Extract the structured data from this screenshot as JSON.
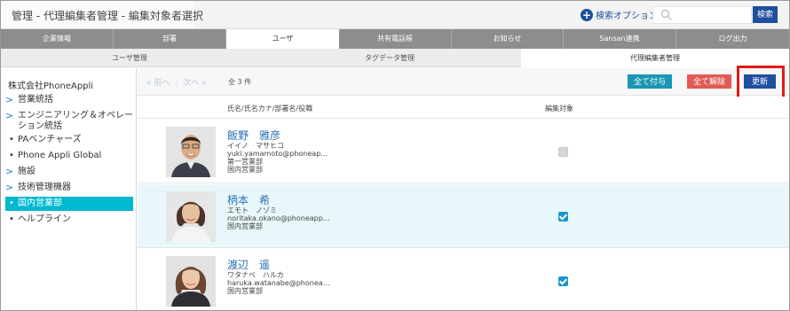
{
  "header": {
    "breadcrumb": "管理 - 代理編集者管理 - 編集対象者選択",
    "search_option_label": "検索オプション",
    "search_placeholder": "",
    "search_button": "検索"
  },
  "tabs": [
    "企業情報",
    "部署",
    "ユーザ",
    "共有電話帳",
    "お知らせ",
    "Sansan連携",
    "ログ出力"
  ],
  "subtabs": [
    "ユーザ管理",
    "タグデータ管理",
    "代理編集者管理"
  ],
  "sidebar": {
    "company": "株式会社PhoneAppli",
    "items": [
      {
        "label": "営業統括",
        "marker": ">"
      },
      {
        "label": "エンジニアリング＆オペレー",
        "label2": "ション統括",
        "marker": ">"
      },
      {
        "label": "PAベンチャーズ",
        "marker": "•"
      },
      {
        "label": "Phone Appli Global",
        "marker": "•"
      },
      {
        "label": "施設",
        "marker": ">"
      },
      {
        "label": "技術管理機器",
        "marker": ">"
      },
      {
        "label": "国内営業部",
        "marker": "•"
      },
      {
        "label": "ヘルプライン",
        "marker": "•"
      }
    ]
  },
  "toolbar": {
    "prev": "« 前へ",
    "next": "次へ »",
    "count": "全 3 件",
    "grant_all": "全て付与",
    "clear_all": "全て解除",
    "update": "更新"
  },
  "columns": {
    "name": "氏名/氏名カナ/部署名/役職",
    "target": "編集対象"
  },
  "people": [
    {
      "name": "飯野　雅彦",
      "kana": "イイノ　マサヒコ",
      "email": "yuki.yamamoto@phoneap…",
      "dept1": "第一営業部",
      "dept2": "国内営業部",
      "checked": false
    },
    {
      "name": "柄本　希",
      "kana": "エモト　ノゾミ",
      "email": "noritaka.okano@phoneapp…",
      "dept1": "国内営業部",
      "dept2": "",
      "checked": true
    },
    {
      "name": "渡辺　遥",
      "kana": "ワタナベ　ハルカ",
      "email": "haruka.watanabe@phonea…",
      "dept1": "国内営業部",
      "dept2": "",
      "checked": true
    }
  ],
  "colors": {
    "accent_blue": "#1f4fa0",
    "teal_button": "#1b96b3",
    "red_button": "#e15a54",
    "active_sidebar": "#00b8d0",
    "highlight": "#e11a1a"
  }
}
